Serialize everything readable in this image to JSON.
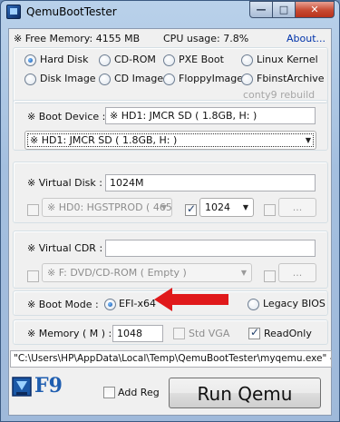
{
  "window": {
    "title": "QemuBootTester",
    "min_glyph": "—",
    "max_glyph": "□",
    "close_glyph": "✕"
  },
  "status": {
    "free_memory": "※ Free Memory: 4155 MB",
    "cpu_usage": "CPU usage: 7.8%",
    "about": "About..."
  },
  "boot_source": {
    "options": [
      {
        "label": "Hard Disk",
        "selected": true
      },
      {
        "label": "CD-ROM",
        "selected": false
      },
      {
        "label": "PXE Boot",
        "selected": false
      },
      {
        "label": "Linux Kernel",
        "selected": false
      },
      {
        "label": "Disk Image",
        "selected": false
      },
      {
        "label": "CD Image",
        "selected": false
      },
      {
        "label": "FloppyImage",
        "selected": false
      },
      {
        "label": "FbinstArchive",
        "selected": false
      }
    ],
    "credit": "conty9 rebuild"
  },
  "boot_device": {
    "label": "※ Boot Device :",
    "value": "※ HD1: JMCR SD ( 1.8GB,  H: )",
    "select_value": "※ HD1: JMCR SD ( 1.8GB,  H: )"
  },
  "virtual_disk": {
    "label": "※ Virtual Disk :",
    "size_value": "1024M",
    "disk_select": "※ HD0: HGSTPROD ( 465",
    "size_checked": true,
    "size_select": "1024",
    "browse_label": "..."
  },
  "virtual_cdr": {
    "label": "※ Virtual CDR :",
    "path_value": "",
    "drive_select": "※ F: DVD/CD-ROM ( Empty )",
    "browse_label": "..."
  },
  "boot_mode": {
    "label": "※ Boot Mode :",
    "efi_label": "EFI-x64",
    "efi_selected": true,
    "legacy_label": "Legacy BIOS",
    "legacy_selected": false
  },
  "memory": {
    "label": "※ Memory ( M ) :",
    "value": "1048",
    "std_vga_label": "Std VGA",
    "std_vga_checked": false,
    "readonly_label": "ReadOnly",
    "readonly_checked": true
  },
  "command_line": "\"C:\\Users\\HP\\AppData\\Local\\Temp\\QemuBootTester\\myqemu.exe\" -L \"C",
  "footer": {
    "logo_text": "F9",
    "add_reg_label": "Add Reg",
    "add_reg_checked": false,
    "run_label": "Run Qemu"
  },
  "colors": {
    "accent_arrow": "#e0191b",
    "link": "#0033aa",
    "window_frame": "#a4bfdf"
  }
}
